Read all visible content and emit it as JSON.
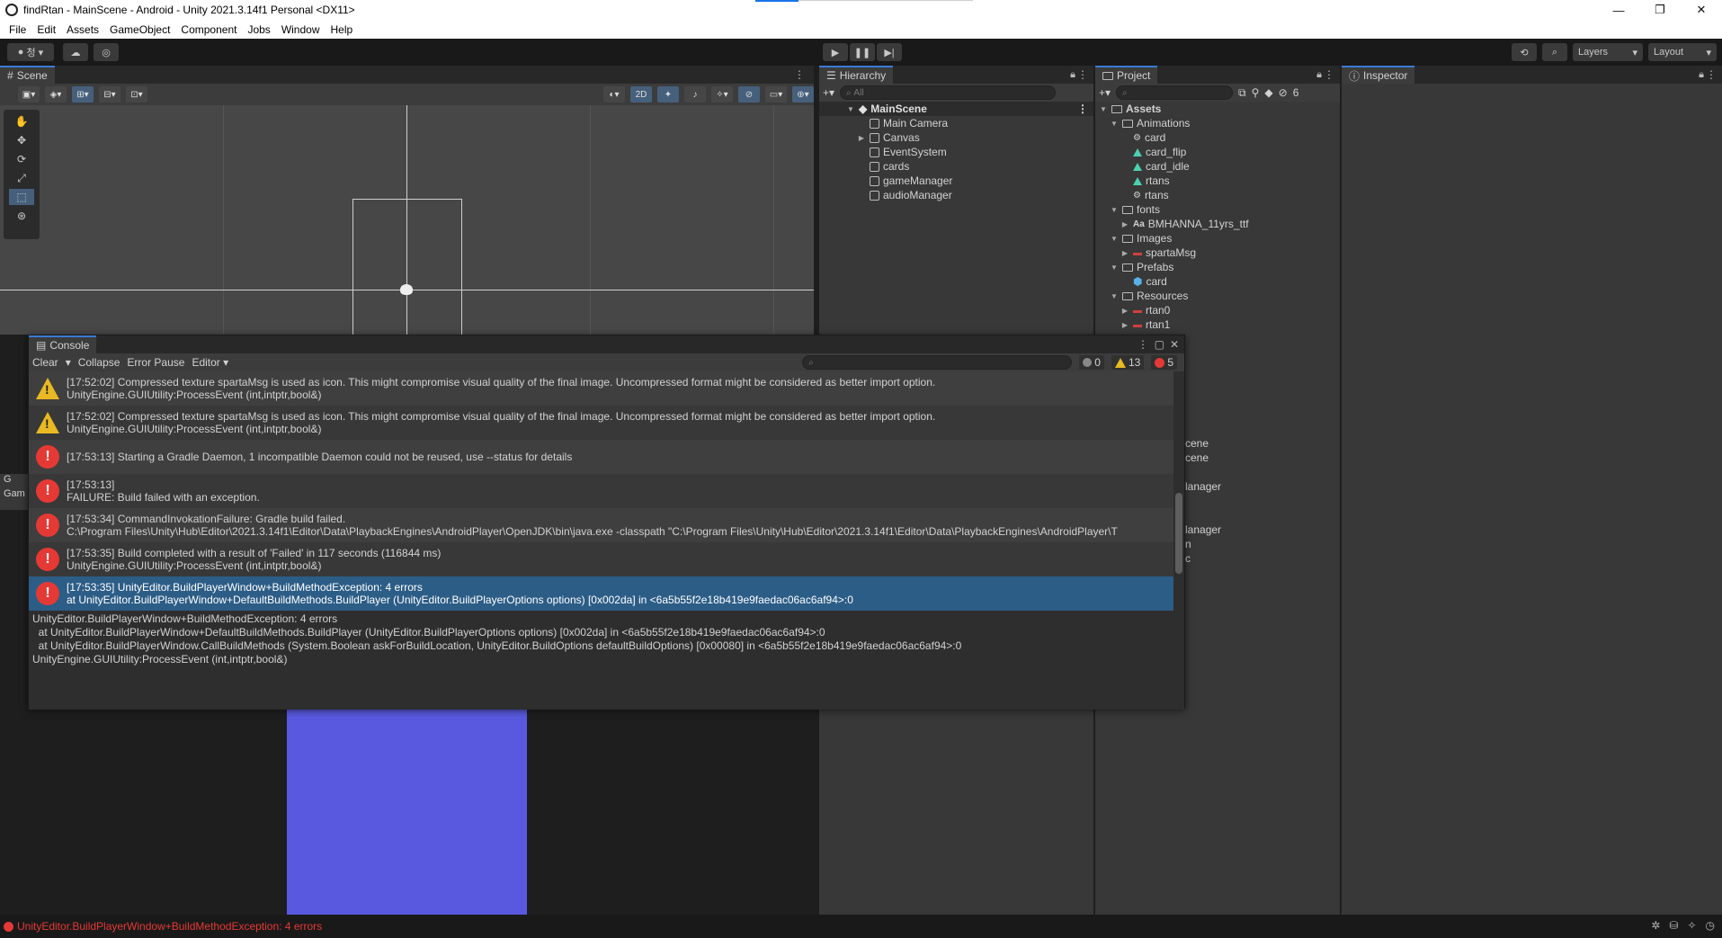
{
  "window": {
    "title": "findRtan - MainScene - Android - Unity 2021.3.14f1 Personal <DX11>",
    "controls": [
      "—",
      "❐",
      "✕"
    ]
  },
  "menu": [
    "File",
    "Edit",
    "Assets",
    "GameObject",
    "Component",
    "Jobs",
    "Window",
    "Help"
  ],
  "toolbar": {
    "account_label": "청",
    "play": "▶",
    "pause": "❚❚",
    "step": "▶|",
    "layers_label": "Layers",
    "layout_label": "Layout"
  },
  "scene": {
    "tab_label": "Scene",
    "mode_2d": "2D"
  },
  "game": {
    "tab_label": "G",
    "tab_label2": "Gam"
  },
  "hierarchy": {
    "tab_label": "Hierarchy",
    "search_placeholder": "All",
    "scene_name": "MainScene",
    "items": [
      "Main Camera",
      "Canvas",
      "EventSystem",
      "cards",
      "gameManager",
      "audioManager"
    ]
  },
  "project": {
    "tab_label": "Project",
    "hidden_count": "6",
    "tree": [
      {
        "label": "Assets",
        "depth": 0,
        "icon": "folder",
        "bold": true
      },
      {
        "label": "Animations",
        "depth": 1,
        "icon": "folder"
      },
      {
        "label": "card",
        "depth": 2,
        "icon": "controller"
      },
      {
        "label": "card_flip",
        "depth": 2,
        "icon": "anim"
      },
      {
        "label": "card_idle",
        "depth": 2,
        "icon": "anim"
      },
      {
        "label": "rtans",
        "depth": 2,
        "icon": "anim"
      },
      {
        "label": "rtans",
        "depth": 2,
        "icon": "controller"
      },
      {
        "label": "fonts",
        "depth": 1,
        "icon": "folder"
      },
      {
        "label": "BMHANNA_11yrs_ttf",
        "depth": 2,
        "icon": "font"
      },
      {
        "label": "Images",
        "depth": 1,
        "icon": "folder"
      },
      {
        "label": "spartaMsg",
        "depth": 2,
        "icon": "image"
      },
      {
        "label": "Prefabs",
        "depth": 1,
        "icon": "folder"
      },
      {
        "label": "card",
        "depth": 2,
        "icon": "prefab"
      },
      {
        "label": "Resources",
        "depth": 1,
        "icon": "folder"
      },
      {
        "label": "rtan0",
        "depth": 2,
        "icon": "image"
      },
      {
        "label": "rtan1",
        "depth": 2,
        "icon": "image"
      }
    ],
    "partial": [
      "cene",
      "cene",
      "lanager",
      "lanager",
      "n",
      "c"
    ]
  },
  "inspector": {
    "tab_label": "Inspector"
  },
  "console": {
    "tab_label": "Console",
    "clear": "Clear",
    "collapse": "Collapse",
    "error_pause": "Error Pause",
    "editor": "Editor",
    "count_info": "0",
    "count_warn": "13",
    "count_error": "5",
    "entries": [
      {
        "type": "warning",
        "line1": "[17:52:02] Compressed texture spartaMsg is used as icon. This might compromise visual quality of the final image. Uncompressed format might be considered as better import option.",
        "line2": "UnityEngine.GUIUtility:ProcessEvent (int,intptr,bool&)"
      },
      {
        "type": "warning",
        "line1": "[17:52:02] Compressed texture spartaMsg is used as icon. This might compromise visual quality of the final image. Uncompressed format might be considered as better import option.",
        "line2": "UnityEngine.GUIUtility:ProcessEvent (int,intptr,bool&)"
      },
      {
        "type": "error",
        "line1": "[17:53:13] Starting a Gradle Daemon, 1 incompatible Daemon could not be reused, use --status for details",
        "line2": ""
      },
      {
        "type": "error",
        "line1": "[17:53:13]",
        "line2": "FAILURE: Build failed with an exception."
      },
      {
        "type": "error",
        "line1": "[17:53:34] CommandInvokationFailure: Gradle build failed.",
        "line2": "C:\\Program Files\\Unity\\Hub\\Editor\\2021.3.14f1\\Editor\\Data\\PlaybackEngines\\AndroidPlayer\\OpenJDK\\bin\\java.exe -classpath \"C:\\Program Files\\Unity\\Hub\\Editor\\2021.3.14f1\\Editor\\Data\\PlaybackEngines\\AndroidPlayer\\T"
      },
      {
        "type": "error",
        "line1": "[17:53:35] Build completed with a result of 'Failed' in 117 seconds (116844 ms)",
        "line2": "UnityEngine.GUIUtility:ProcessEvent (int,intptr,bool&)"
      },
      {
        "type": "error",
        "selected": true,
        "line1": "[17:53:35] UnityEditor.BuildPlayerWindow+BuildMethodException: 4 errors",
        "line2": "  at UnityEditor.BuildPlayerWindow+DefaultBuildMethods.BuildPlayer (UnityEditor.BuildPlayerOptions options) [0x002da] in <6a5b55f2e18b419e9faedac06ac6af94>:0"
      }
    ],
    "detail": "UnityEditor.BuildPlayerWindow+BuildMethodException: 4 errors\n  at UnityEditor.BuildPlayerWindow+DefaultBuildMethods.BuildPlayer (UnityEditor.BuildPlayerOptions options) [0x002da] in <6a5b55f2e18b419e9faedac06ac6af94>:0\n  at UnityEditor.BuildPlayerWindow.CallBuildMethods (System.Boolean askForBuildLocation, UnityEditor.BuildOptions defaultBuildOptions) [0x00080] in <6a5b55f2e18b419e9faedac06ac6af94>:0\nUnityEngine.GUIUtility:ProcessEvent (int,intptr,bool&)"
  },
  "status": {
    "message": "UnityEditor.BuildPlayerWindow+BuildMethodException: 4 errors"
  },
  "colors": {
    "accent": "#3a7bd5",
    "error": "#e53935",
    "warning": "#e8b923",
    "selection": "#2c5d87",
    "game_card": "#5959e0"
  }
}
